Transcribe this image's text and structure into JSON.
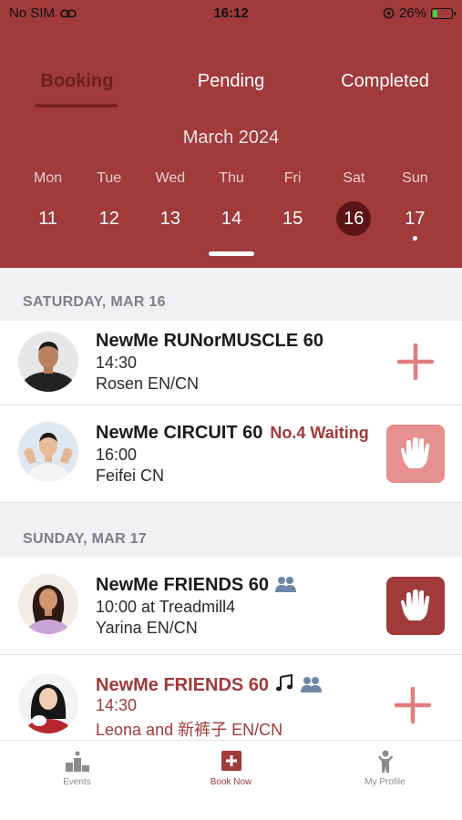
{
  "status_bar": {
    "carrier": "No SIM",
    "time": "16:12",
    "battery_percent": "26%",
    "battery_level": 0.26
  },
  "tabs": [
    {
      "label": "Booking",
      "active": true
    },
    {
      "label": "Pending",
      "active": false
    },
    {
      "label": "Completed",
      "active": false
    }
  ],
  "calendar": {
    "month": "March 2024",
    "weekdays": [
      "Mon",
      "Tue",
      "Wed",
      "Thu",
      "Fri",
      "Sat",
      "Sun"
    ],
    "days": [
      "11",
      "12",
      "13",
      "14",
      "15",
      "16",
      "17"
    ],
    "selected_day": "16",
    "days_with_dot": [
      "17"
    ]
  },
  "sections": [
    {
      "header": "SATURDAY, MAR 16",
      "classes": [
        {
          "title": "NewMe RUNorMUSCLE 60",
          "time": "14:30",
          "instructor": "Rosen EN/CN",
          "action": "add"
        },
        {
          "title": "NewMe CIRCUIT 60",
          "waiting": "No.4 Waiting",
          "time": "16:00",
          "instructor": "Feifei CN",
          "action": "waitlist"
        }
      ]
    },
    {
      "header": "SUNDAY, MAR 17",
      "classes": [
        {
          "title": "NewMe FRIENDS 60",
          "time": "10:00 at Treadmill4",
          "instructor": "Yarina EN/CN",
          "action": "booked"
        },
        {
          "title": "NewMe FRIENDS 60",
          "time": "14:30",
          "instructor": "Leona and 新裤子  EN/CN",
          "action": "add"
        }
      ]
    }
  ],
  "tabbar": [
    {
      "label": "Events",
      "icon": "podium-icon"
    },
    {
      "label": "Book Now",
      "icon": "plus-square-icon",
      "active": true
    },
    {
      "label": "My Profile",
      "icon": "person-icon"
    }
  ],
  "colors": {
    "brand": "#a13a3b",
    "brand_dark": "#5b1516",
    "plus": "#e27d7e",
    "hand_light": "#e6908f",
    "hand_dark": "#a13a3b",
    "friends_icon": "#6d86a8"
  }
}
